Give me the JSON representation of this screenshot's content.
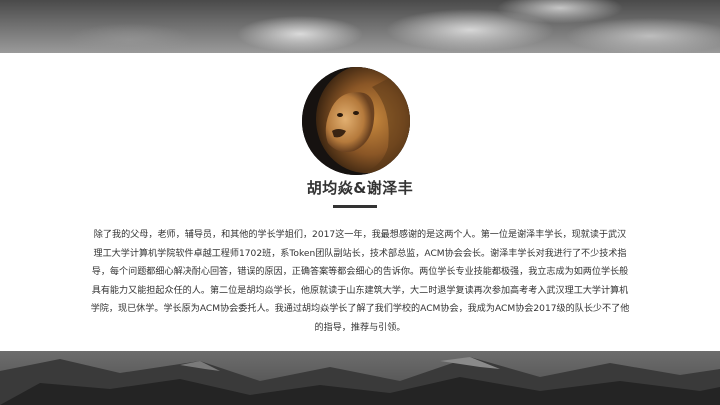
{
  "person": {
    "name": "胡均焱&谢泽丰",
    "bio": "除了我的父母，老师，辅导员，和其他的学长学姐们，2017这一年，我最想感谢的是这两个人。第一位是谢泽丰学长，现就读于武汉理工大学计算机学院软件卓越工程师1702班，系Token团队副站长，技术部总监，ACM协会会长。谢泽丰学长对我进行了不少技术指导，每个问题都细心解决耐心回答，错误的原因，正确答案等都会细心的告诉你。两位学长专业技能都极强，我立志成为如两位学长般具有能力又能担起众任的人。第二位是胡均焱学长，他原就读于山东建筑大学，大二时退学复读再次参加高考考入武汉理工大学计算机学院，现已休学。学长原为ACM协会委托人。我通过胡均焱学长了解了我们学校的ACM协会，我成为ACM协会2017级的队长少不了他的指导，推荐与引领。"
  },
  "theme": {
    "text_color": "#333333",
    "accent_color": "#333333",
    "background": "#ffffff"
  },
  "icons": {
    "avatar": "lion-photo"
  }
}
